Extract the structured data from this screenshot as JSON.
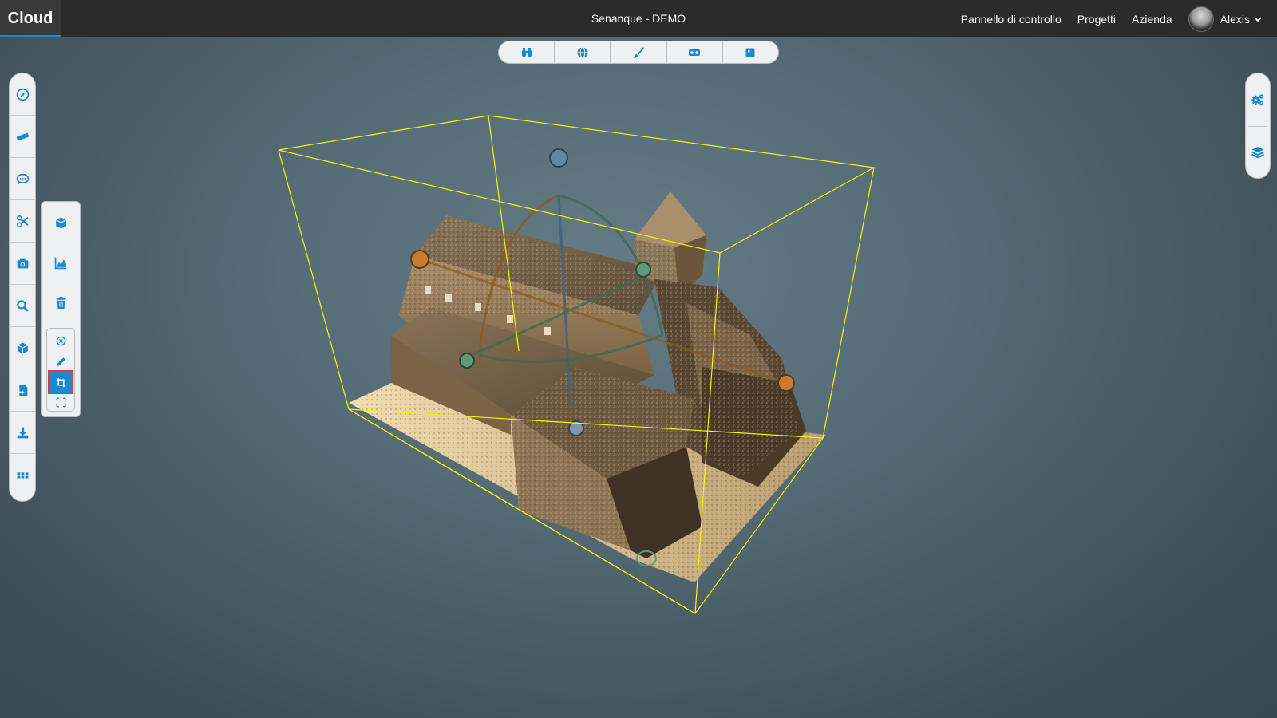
{
  "app": {
    "logo": "Cloud",
    "project_title": "Senanque - DEMO"
  },
  "nav": {
    "items": [
      {
        "label": "Pannello di controllo"
      },
      {
        "label": "Progetti"
      },
      {
        "label": "Azienda"
      }
    ],
    "user": {
      "name": "Alexis"
    }
  },
  "modebar": {
    "buttons": [
      {
        "icon": "binoculars-icon"
      },
      {
        "icon": "globe-icon"
      },
      {
        "icon": "paintbrush-icon"
      },
      {
        "icon": "vr-headset-icon"
      },
      {
        "icon": "square-panel-icon"
      }
    ]
  },
  "left_toolbar": {
    "tools": [
      {
        "icon": "compass-icon"
      },
      {
        "icon": "ruler-icon"
      },
      {
        "icon": "comment-icon"
      },
      {
        "icon": "scissors-icon"
      },
      {
        "icon": "camera-icon"
      },
      {
        "icon": "search-icon"
      },
      {
        "icon": "cube-icon"
      },
      {
        "icon": "file-import-icon"
      },
      {
        "icon": "download-icon"
      },
      {
        "icon": "apps-grid-icon"
      }
    ]
  },
  "clip_panel": {
    "tools": [
      {
        "icon": "cube-icon"
      },
      {
        "icon": "chart-area-icon"
      },
      {
        "icon": "trash-icon"
      }
    ],
    "subtools": [
      {
        "icon": "close-circle-icon",
        "active": false
      },
      {
        "icon": "pencil-icon",
        "active": false
      },
      {
        "icon": "crop-icon",
        "active": true
      },
      {
        "icon": "expand-icon",
        "active": false
      }
    ]
  },
  "right_toolbar": {
    "tools": [
      {
        "icon": "gears-icon"
      },
      {
        "icon": "layers-icon"
      }
    ]
  },
  "colors": {
    "accent": "#1a8ad0",
    "topbar": "#2b2b2b",
    "clip_box": "#f5f500",
    "active_outline": "#e53935"
  }
}
